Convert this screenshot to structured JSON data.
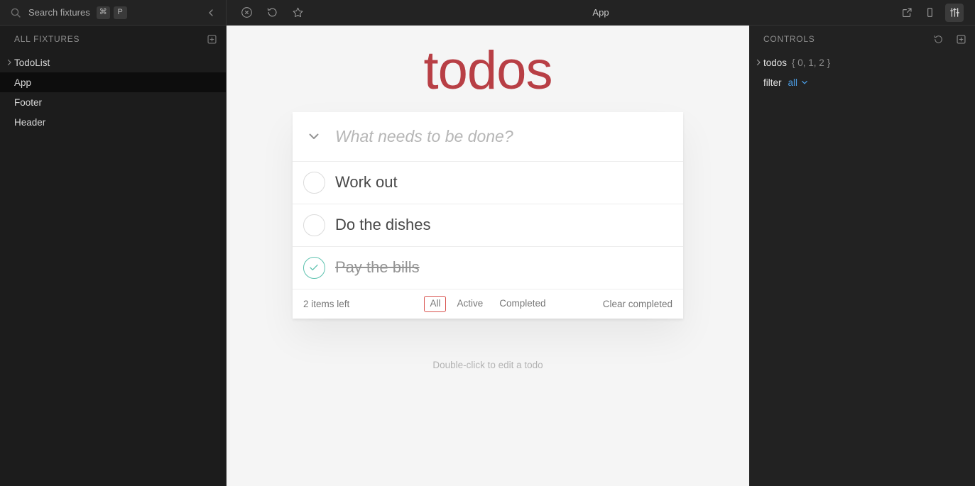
{
  "search": {
    "placeholder": "Search fixtures",
    "icon": "search-icon",
    "shortcut_keys": [
      "⌘",
      "P"
    ],
    "collapse_icon": "chevron-left-icon"
  },
  "toolbar": {
    "title": "App",
    "left_icons": [
      {
        "name": "close-circle-icon",
        "label": "Close"
      },
      {
        "name": "reload-icon",
        "label": "Reload"
      },
      {
        "name": "star-icon",
        "label": "Favorite"
      }
    ],
    "right_icons": [
      {
        "name": "external-link-icon",
        "label": "Open in new tab"
      },
      {
        "name": "device-icon",
        "label": "Responsive preview"
      },
      {
        "name": "sliders-icon",
        "label": "Controls",
        "active": true
      }
    ]
  },
  "sidebar": {
    "section_title": "ALL FIXTURES",
    "add_icon": "square-plus-icon",
    "items": [
      {
        "label": "TodoList",
        "expandable": true,
        "selected": false
      },
      {
        "label": "App",
        "expandable": false,
        "selected": true
      },
      {
        "label": "Footer",
        "expandable": false,
        "selected": false
      },
      {
        "label": "Header",
        "expandable": false,
        "selected": false
      }
    ]
  },
  "todos_app": {
    "title": "todos",
    "title_color": "#b83f45",
    "toggle_all_icon": "chevron-down-icon",
    "new_todo_placeholder": "What needs to be done?",
    "new_todo_value": "",
    "items": [
      {
        "label": "Work out",
        "completed": false
      },
      {
        "label": "Do the dishes",
        "completed": false
      },
      {
        "label": "Pay the bills",
        "completed": true
      }
    ],
    "footer": {
      "count_text": "2 items left",
      "filters": [
        {
          "label": "All",
          "selected": true
        },
        {
          "label": "Active",
          "selected": false
        },
        {
          "label": "Completed",
          "selected": false
        }
      ],
      "clear_label": "Clear completed",
      "selected_filter_color": "#d9534f"
    },
    "hint": "Double-click to edit a todo"
  },
  "controls": {
    "title": "CONTROLS",
    "reset_icon": "reset-icon",
    "add_icon": "square-plus-icon",
    "rows": [
      {
        "key": "todos",
        "value_dim": "{ 0, 1, 2 }",
        "expandable": true,
        "value_link": "",
        "has_caret": false
      },
      {
        "key": "filter",
        "value_dim": "",
        "expandable": false,
        "value_link": "all",
        "has_caret": true
      }
    ],
    "link_color": "#4a9ae0"
  }
}
